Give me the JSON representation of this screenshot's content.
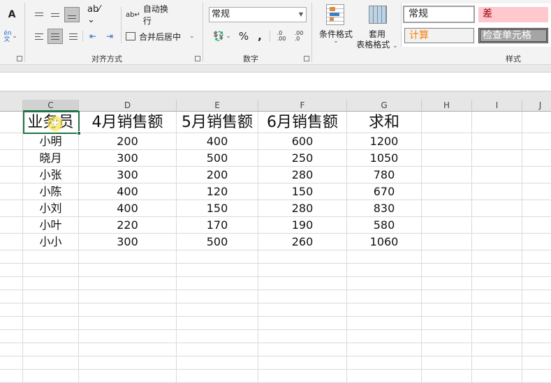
{
  "ribbon": {
    "font_partial": {
      "phonetic_label": "én\n文"
    },
    "alignment": {
      "wrap_text": "自动换行",
      "merge_center": "合并后居中",
      "group_label": "对齐方式"
    },
    "number": {
      "format_value": "常规",
      "percent": "%",
      "comma": ",",
      "inc_decimal": ".0\n.00",
      "dec_decimal": ".00\n.0",
      "group_label": "数字"
    },
    "styles": {
      "conditional_format": "条件格式",
      "table_format_1": "套用",
      "table_format_2": "表格格式",
      "normal": "常规",
      "bad": "差",
      "calculation": "计算",
      "check_cell": "检查单元格",
      "group_label": "样式",
      "bad_bg": "#ffc7ce",
      "calc_color": "#fa7d00",
      "check_bg": "#a5a5a5"
    }
  },
  "sheet": {
    "columns": [
      "C",
      "D",
      "E",
      "F",
      "G",
      "H",
      "I",
      "J"
    ],
    "active_column": "C",
    "header_row": [
      "业务员",
      "4月销售额",
      "5月销售额",
      "6月销售额",
      "求和"
    ],
    "rows": [
      [
        "小明",
        "200",
        "400",
        "600",
        "1200"
      ],
      [
        "晓月",
        "300",
        "500",
        "250",
        "1050"
      ],
      [
        "小张",
        "300",
        "200",
        "280",
        "780"
      ],
      [
        "小陈",
        "400",
        "120",
        "150",
        "670"
      ],
      [
        "小刘",
        "400",
        "150",
        "280",
        "830"
      ],
      [
        "小叶",
        "220",
        "170",
        "190",
        "580"
      ],
      [
        "小小",
        "300",
        "500",
        "260",
        "1060"
      ]
    ],
    "accent": "#217346"
  }
}
